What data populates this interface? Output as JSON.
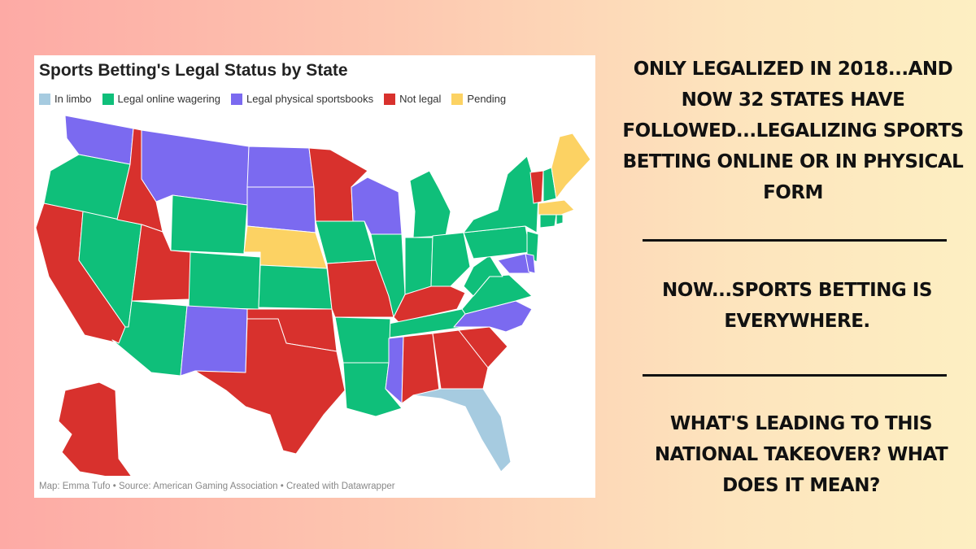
{
  "map": {
    "title": "Sports Betting's Legal Status by State",
    "footnote": "Map: Emma Tufo • Source: American Gaming Association • Created with Datawrapper",
    "legend": [
      {
        "label": "In limbo",
        "color": "#a6cbe0"
      },
      {
        "label": "Legal online wagering",
        "color": "#0fbf7a"
      },
      {
        "label": "Legal physical sportsbooks",
        "color": "#7b6af0"
      },
      {
        "label": "Not legal",
        "color": "#d8312d"
      },
      {
        "label": "Pending",
        "color": "#fcd263"
      }
    ]
  },
  "captions": {
    "headline": "ONLY LEGALIZED IN 2018...AND NOW 32 STATES HAVE FOLLOWED...LEGALIZING SPORTS BETTING ONLINE OR IN PHYSICAL FORM",
    "middle": "NOW...SPORTS BETTING IS EVERYWHERE.",
    "question": "WHAT'S LEADING TO THIS NATIONAL TAKEOVER? WHAT DOES IT MEAN?"
  }
}
